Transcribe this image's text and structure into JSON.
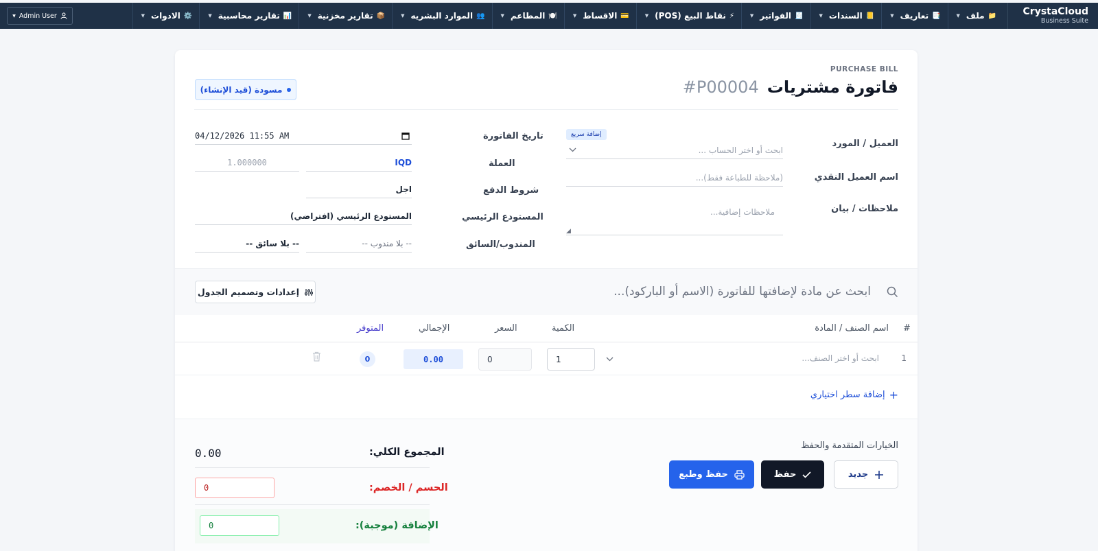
{
  "brand": {
    "name": "CrystaCloud",
    "sub": "Business Suite"
  },
  "nav": [
    {
      "label": "ملف",
      "icon": "📁"
    },
    {
      "label": "تعاريف",
      "icon": "📑"
    },
    {
      "label": "السندات",
      "icon": "📒"
    },
    {
      "label": "الفواتير",
      "icon": "🧾"
    },
    {
      "label": "نقاط البيع (POS)",
      "icon": "⚡"
    },
    {
      "label": "الاقساط",
      "icon": "💳"
    },
    {
      "label": "المطاعم",
      "icon": "🍽️"
    },
    {
      "label": "الموارد البشريه",
      "icon": "👥"
    },
    {
      "label": "تقارير مخزنية",
      "icon": "📦"
    },
    {
      "label": "تقارير محاسبية",
      "icon": "📊"
    },
    {
      "label": "الادوات",
      "icon": "⚙️"
    }
  ],
  "user": {
    "name": "Admin User"
  },
  "header": {
    "subheading": "PURCHASE BILL",
    "title": "فاتورة مشتريات",
    "number": "#P00004",
    "status": "مسودة (قيد الإنشاء)"
  },
  "form": {
    "customer_label": "العميل / المورد",
    "customer_placeholder": "ابحث أو اختر الحساب ...",
    "quick_add": "إضافة سريع",
    "cash_name_label": "اسم العميل النقدي",
    "cash_name_placeholder": "(ملاحظة للطباعة فقط)...",
    "notes_label": "ملاحظات / بيان",
    "notes_placeholder": "ملاحظات إضافية...",
    "date_label": "تاريخ الفاتورة",
    "date_value": "04/12/2026  11:55 AM",
    "currency_label": "العملة",
    "currency_value": "IQD",
    "exchange_rate": "1.000000",
    "payment_label": "شروط الدفع",
    "payment_value": "اجل",
    "warehouse_label": "المستودع الرئيسي",
    "warehouse_value": "المستودع الرئيسي (افتراضي)",
    "agent_label": "المندوب/السائق",
    "rep_value": "-- بلا مندوب --",
    "driver_value": "-- بلا سائق --"
  },
  "items": {
    "search_placeholder": "ابحث عن مادة لإضافتها للفاتورة (الاسم أو الباركود)...",
    "settings_button": "إعدادات وتصميم الجدول",
    "columns": {
      "index": "#",
      "name": "اسم الصنف / المادة",
      "qty": "الكمية",
      "price": "السعر",
      "total": "الإجمالي",
      "available": "المتوفر"
    },
    "rows": [
      {
        "index": "1",
        "name_placeholder": "ابحث أو اختر الصنف...",
        "qty": "1",
        "price": "0",
        "total": "0.00",
        "available": "0"
      }
    ],
    "add_line": "إضافة سطر اختياري"
  },
  "footer": {
    "advanced_label": "الخيارات المتقدمة والحفظ",
    "new_button": "جديد",
    "save_button": "حفظ",
    "save_print_button": "حفظ وطبع",
    "grand_total_label": "المجموع الكلي:",
    "grand_total_value": "0.00",
    "discount_label": "الحسم / الخصم:",
    "discount_value": "0",
    "addition_label": "الإضافة (موجبة):",
    "addition_value": "0"
  },
  "colors": {
    "navbar": "#1f3147",
    "primary": "#2563eb",
    "dark_button": "#111827",
    "discount": "#dc2626",
    "addition": "#15803d"
  }
}
